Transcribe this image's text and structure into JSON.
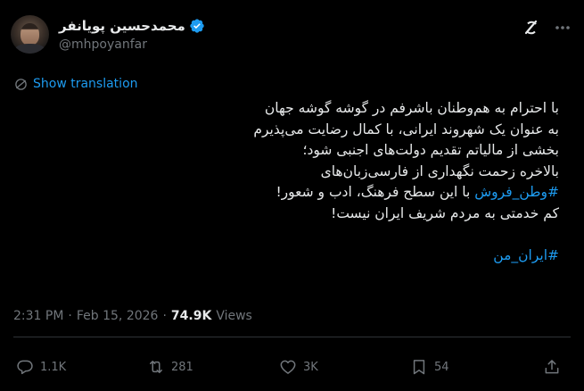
{
  "author": {
    "display_name": "محمدحسین پویانفر",
    "handle": "@mhpoyanfar",
    "verified": true
  },
  "translation": {
    "label": "Show translation"
  },
  "tweet": {
    "lines": [
      "با احترام به هم‌وطنان باشرفم در گوشه گوشه جهان",
      "به عنوان یک شهروند ایرانی، با کمال رضایت می‌پذیرم",
      "بخشی از مالیاتم تقدیم دولت‌های اجنبی شود؛",
      "بالاخره زحمت نگهداری از فارسی‌زبان‌های"
    ],
    "line5": {
      "hashtag": "#وطن_فروش",
      "rest": " با این سطح فرهنگ، ادب و شعور!"
    },
    "line6": "کم خدمتی به مردم شریف ایران نیست!",
    "final_hashtag": "#ایران_من"
  },
  "meta": {
    "time": "2:31 PM",
    "separator": "·",
    "date": "Feb 15, 2026",
    "views_count": "74.9K",
    "views_label": "Views"
  },
  "actions": {
    "reply_count": "1.1K",
    "repost_count": "281",
    "like_count": "3K",
    "bookmark_count": "54"
  },
  "colors": {
    "background": "#000000",
    "text": "#e7e9ea",
    "muted": "#71767b",
    "accent": "#1d9bf0",
    "divider": "#2f3336"
  },
  "icons": {
    "verified": "verified-badge-icon",
    "grok": "grok-icon",
    "more": "more-dots-icon",
    "translate": "globe-icon",
    "reply": "reply-icon",
    "repost": "repost-icon",
    "like": "heart-icon",
    "bookmark": "bookmark-icon",
    "share": "share-icon"
  }
}
